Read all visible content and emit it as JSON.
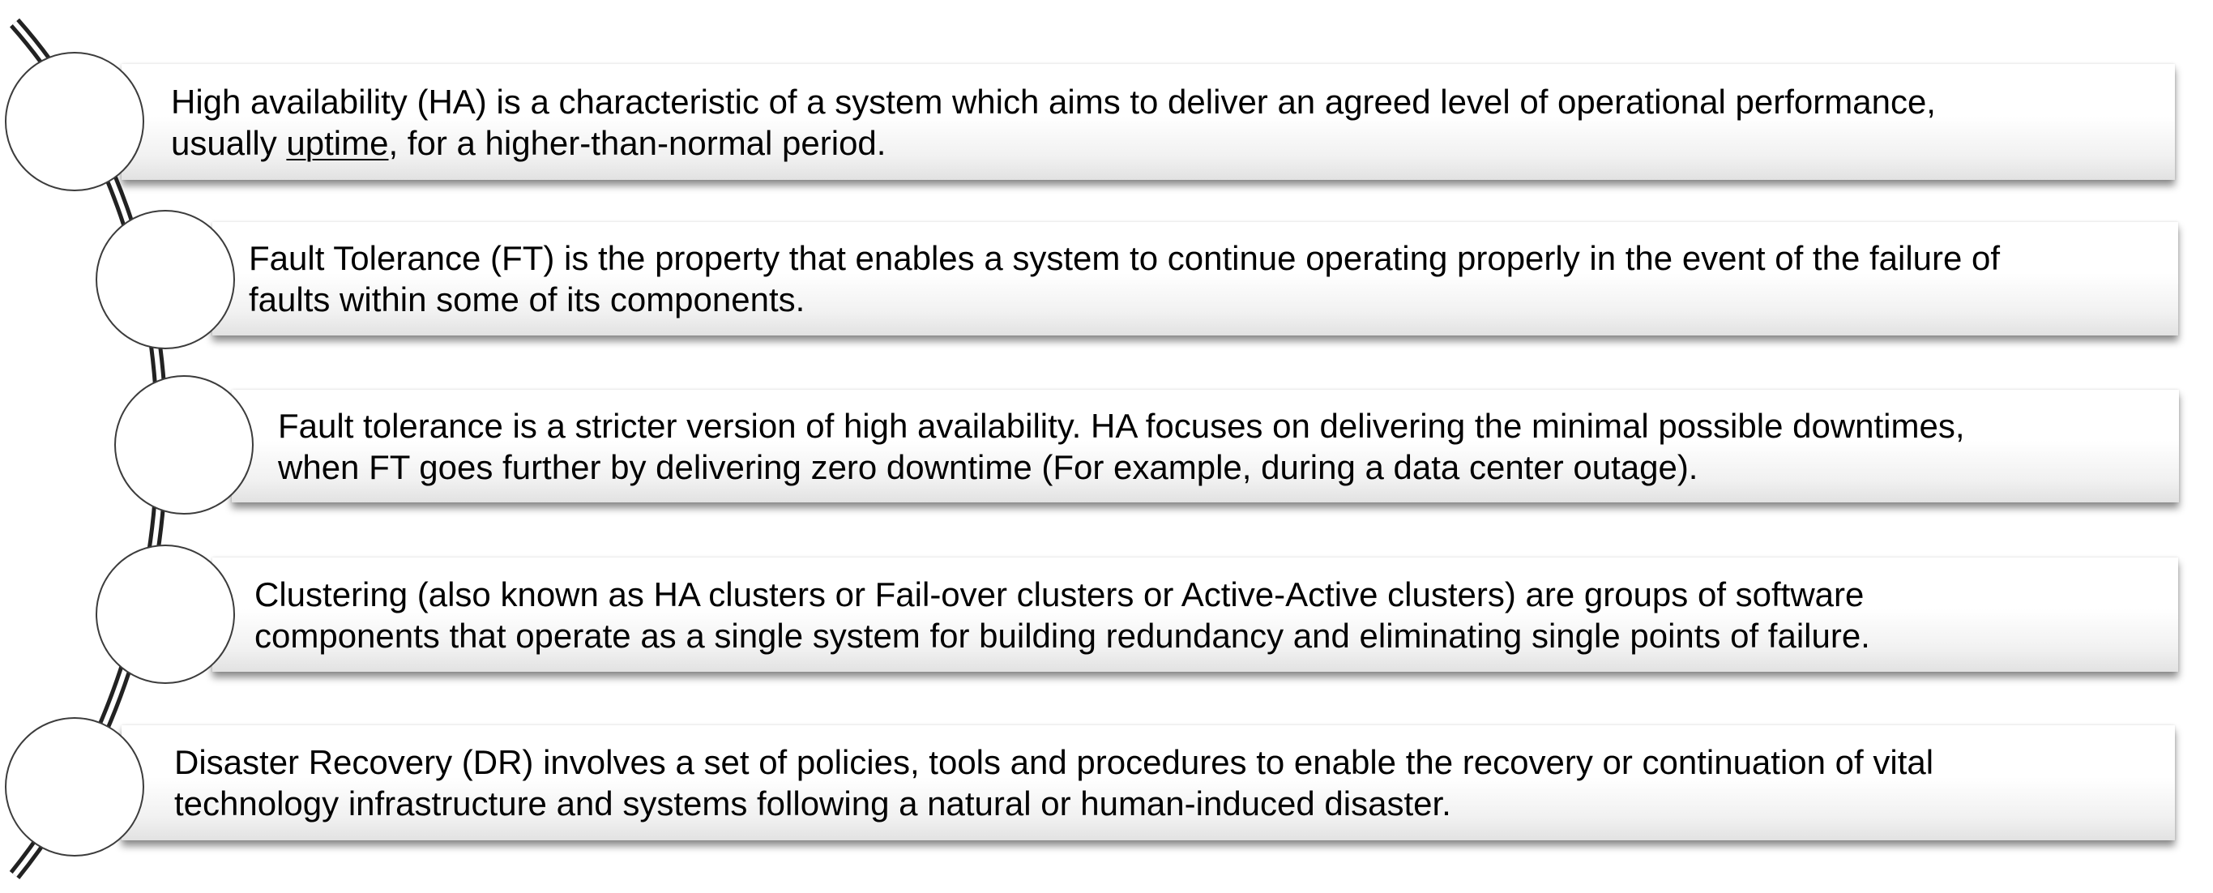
{
  "items": [
    {
      "line1": "High availability (HA) is a characteristic of a system which aims to deliver an agreed level of operational performance,",
      "line2_prefix": "usually ",
      "line2_link": "uptime",
      "line2_suffix": ", for a higher-than-normal period."
    },
    {
      "line1": "Fault Tolerance (FT) is the property that enables a system to continue operating properly in the event of the failure of",
      "line2": "faults within some of its components."
    },
    {
      "line1": "Fault tolerance is a stricter version of high availability. HA focuses on delivering the minimal possible downtimes,",
      "line2": "when FT goes further by delivering zero downtime (For example, during a data center outage)."
    },
    {
      "line1": "Clustering (also known as HA clusters or Fail-over clusters or Active-Active clusters) are groups of software",
      "line2": "components that operate as a single system for building redundancy and eliminating single points of failure."
    },
    {
      "line1": "Disaster Recovery (DR) involves a set of policies, tools and procedures to enable the recovery or continuation of vital",
      "line2": "technology infrastructure and systems following a natural or human-induced disaster."
    }
  ]
}
